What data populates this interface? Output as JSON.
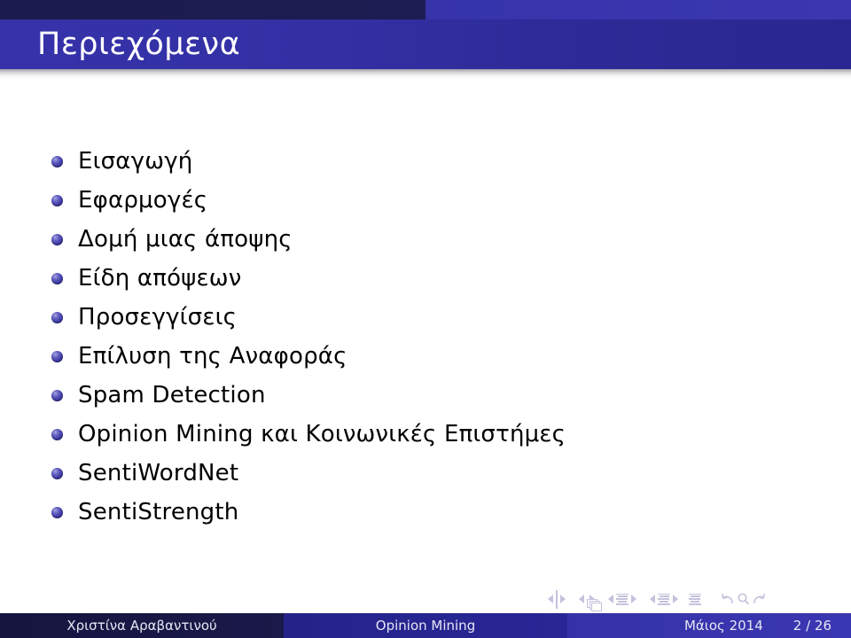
{
  "slide": {
    "title": "Περιεχόμενα",
    "page_label": "2 / 26"
  },
  "colors": {
    "header_dark_left": "#1c1b4d",
    "header_dark_right": "#3633ab",
    "header_title_bar": "#3330a4",
    "title_text": "#ffffff",
    "bullet_ball": "#3b38a0",
    "body_text": "#000000",
    "footer_left": "#16153f",
    "footer_center": "#25238a",
    "footer_right": "#3532a8",
    "footer_text": "#e6e6f5",
    "nav_symbol": "#c3c3de"
  },
  "outline": {
    "items": [
      {
        "label": "Εισαγωγή"
      },
      {
        "label": "Εφαρμογές"
      },
      {
        "label": "Δομή μιας άποψης"
      },
      {
        "label": "Είδη απόψεων"
      },
      {
        "label": "Προσεγγίσεις"
      },
      {
        "label": "Επίλυση της Αναφοράς"
      },
      {
        "label": "Spam Detection"
      },
      {
        "label": "Opinion Mining και Κοινωνικές Επιστήμες"
      },
      {
        "label": "SentiWordNet"
      },
      {
        "label": "SentiStrength"
      }
    ]
  },
  "navigation": {
    "groups": [
      {
        "icon": "slide-navigation-icon",
        "prev": "previous-slide",
        "next": "next-slide"
      },
      {
        "icon": "frame-navigation-icon",
        "prev": "previous-frame",
        "next": "next-frame"
      },
      {
        "icon": "subsection-navigation-icon",
        "prev": "previous-subsection",
        "next": "next-subsection"
      },
      {
        "icon": "section-navigation-icon",
        "prev": "previous-section",
        "next": "next-section"
      }
    ],
    "document_icon": "document-navigation-icon",
    "back_icon": "back-icon",
    "search_icon": "search-icon",
    "forward_icon": "forward-icon"
  },
  "footer": {
    "author": "Χριστίνα Αραβαντινού",
    "title": "Opinion Mining",
    "date": "Μάιος 2014",
    "page": "2 / 26"
  }
}
